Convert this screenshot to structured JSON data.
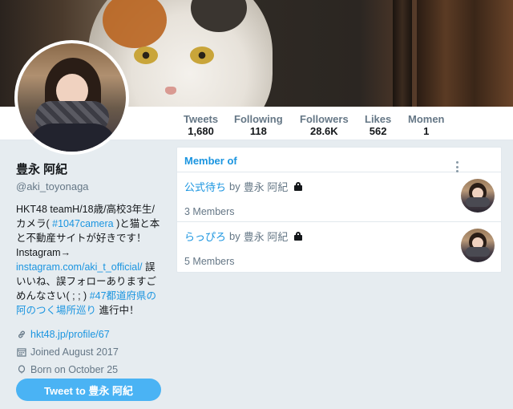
{
  "stats": [
    {
      "label": "Tweets",
      "value": "1,680"
    },
    {
      "label": "Following",
      "value": "118"
    },
    {
      "label": "Followers",
      "value": "28.6K"
    },
    {
      "label": "Likes",
      "value": "562"
    },
    {
      "label": "Momen",
      "value": "1"
    }
  ],
  "profile": {
    "name": "豊永 阿紀",
    "handle": "@aki_toyonaga",
    "bio": {
      "t1": "HKT48 teamH/18歳/高校3年生/カメラ(",
      "tag1": " #1047camera ",
      "t2": ")と猫と本と不動産サイトが好きです！Instagram→ ",
      "link": "instagram.com/aki_t_official/",
      "t3": " 誤いいね、誤フォローありますごめんなさい( ;  ; )",
      "tag2": "#47都道府県の阿のつく場所巡り",
      "t4": " 進行中！"
    },
    "website": "hkt48.jp/profile/67",
    "joined": "Joined August 2017",
    "born": "Born on October 25"
  },
  "tweet_button": "Tweet to 豊永 阿紀",
  "panel": {
    "title": "Member of",
    "lists": [
      {
        "name": "公式待ち",
        "by": "by",
        "owner": "豊永 阿紀",
        "members": "3 Members"
      },
      {
        "name": "らっぴろ",
        "by": "by",
        "owner": "豊永 阿紀",
        "members": "5 Members"
      }
    ]
  },
  "icons": {
    "website": "link-icon",
    "joined": "calendar-icon",
    "born": "balloon-icon",
    "lock": "lock-icon",
    "more": "more-vertical-icon"
  },
  "colors": {
    "accent": "#1b95e0",
    "button": "#4ab3f4",
    "background": "#e6ecf0"
  }
}
